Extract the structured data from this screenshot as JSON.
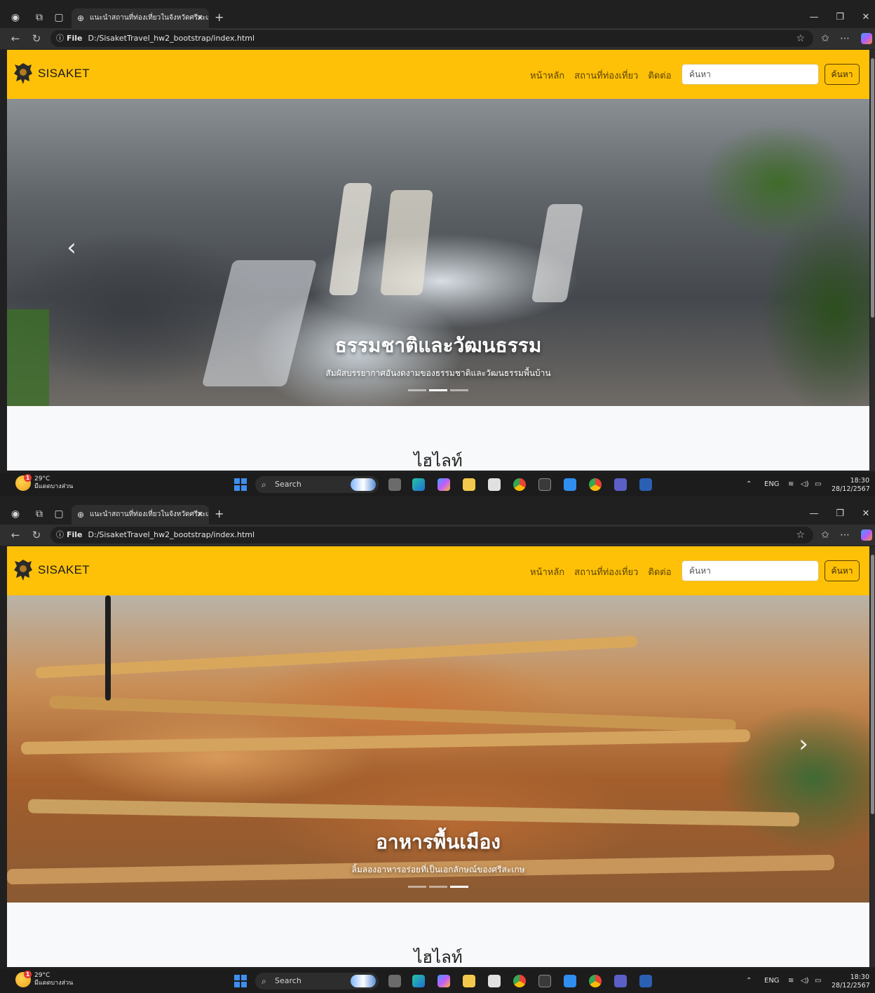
{
  "browser": {
    "tab_title": "แนะนำสถานที่ท่องเที่ยวในจังหวัดศรีสะเกษ",
    "url_prefix": "File",
    "url": "D:/SisaketTravel_hw2_bootstrap/index.html"
  },
  "site": {
    "brand": "SISAKET",
    "nav": [
      "หน้าหลัก",
      "สถานที่ท่องเที่ยว",
      "ติดต่อ"
    ],
    "search_placeholder": "ค้นหา",
    "search_button": "ค้นหา",
    "section_title": "ไฮไลท์"
  },
  "slides": [
    {
      "title": "ธรรมชาติและวัฒนธรรม",
      "subtitle": "สัมผัสบรรยากาศอันงดงามของธรรมชาติและวัฒนธรรมพื้นบ้าน",
      "active_indicator": 1,
      "indicator_count": 3
    },
    {
      "title": "อาหารพื้นเมือง",
      "subtitle": "ลิ้มลองอาหารอร่อยที่เป็นเอกลักษณ์ของศรีสะเกษ",
      "active_indicator": 2,
      "indicator_count": 3
    }
  ],
  "taskbar": {
    "temperature": "29°C",
    "weather_text": "มีแดดบางส่วน",
    "badge": "1",
    "search_label": "Search",
    "language": "ENG",
    "time": "18:30",
    "date": "28/12/2567"
  },
  "icons": {
    "prev": "chevron-left-icon",
    "next": "chevron-right-icon"
  },
  "colors": {
    "navbar": "#ffc107",
    "page_bg": "#f8f9fa"
  }
}
